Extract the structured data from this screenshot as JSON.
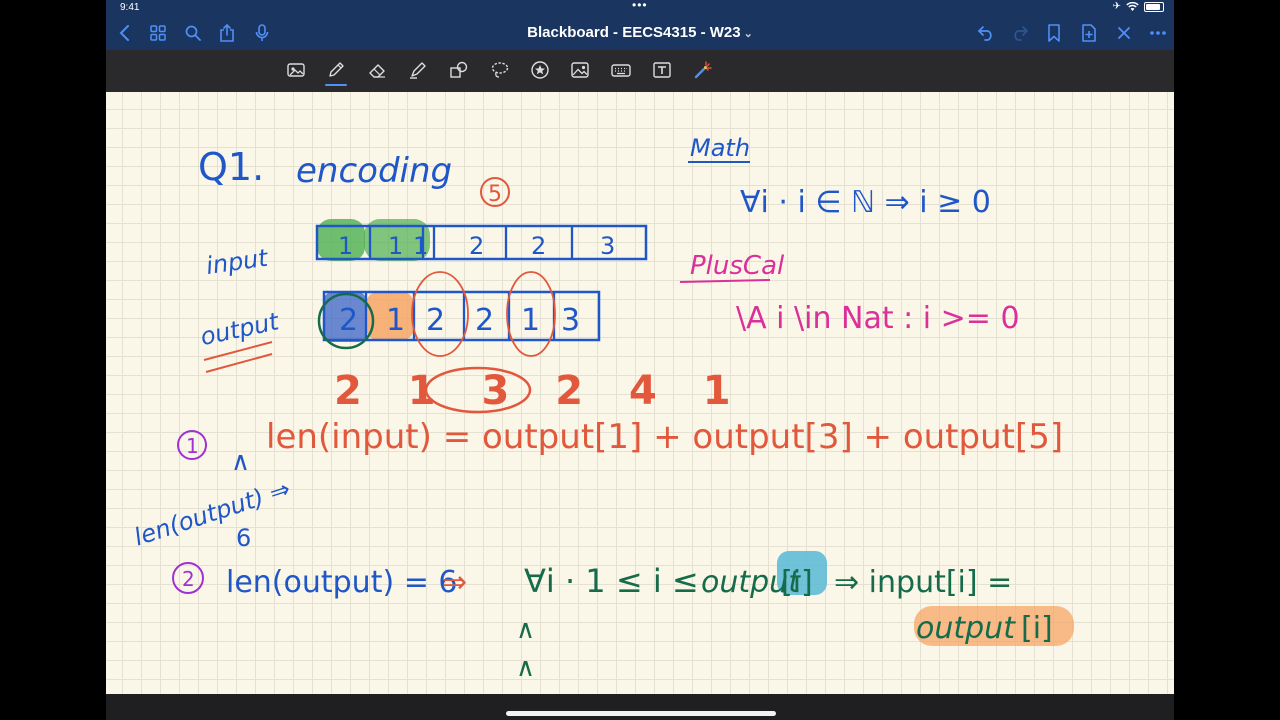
{
  "status_bar": {
    "time": "9:41"
  },
  "nav": {
    "title": "Blackboard - EECS4315 - W23",
    "left_icons": [
      "back-icon",
      "grid-icon",
      "search-icon",
      "share-icon",
      "microphone-icon"
    ],
    "right_icons": [
      "undo-icon",
      "redo-icon",
      "bookmark-icon",
      "add-page-icon",
      "close-icon",
      "more-icon"
    ]
  },
  "toolbar": {
    "tools": [
      "image-scan-icon",
      "pen-icon",
      "eraser-icon",
      "highlighter-icon",
      "shapes-icon",
      "lasso-icon",
      "sticker-icon",
      "photo-icon",
      "keyboard-icon",
      "text-box-icon",
      "laser-pointer-icon"
    ],
    "active_tool": "pen-icon"
  },
  "colors": {
    "accent": "#4f8ff7",
    "nav_background": "#1a3660",
    "paper": "#faf6e8",
    "ink_blue": "#1f57c8",
    "ink_red": "#e2583c",
    "ink_pink": "#db2f9a",
    "ink_green": "#156b4a",
    "ink_purple": "#a031d2",
    "highlight_green": "#4caf50",
    "highlight_orange": "#f6a15c",
    "highlight_cyan": "#57b9d6"
  },
  "notes": {
    "q1": "Q1.",
    "encoding": "encoding",
    "circled_five": "5",
    "input_label": "input",
    "input_cells": [
      "1",
      "1",
      "1",
      "2",
      "2",
      "3"
    ],
    "output_label": "output",
    "output_cells": [
      "2",
      "1",
      "2",
      "2",
      "1",
      "3"
    ],
    "red_digits": "2 1 3 2 4 1",
    "math_title": "Math",
    "math_formula": "∀i · i ∈ ℕ ⇒ i ≥ 0",
    "pluscal_title": "PlusCal",
    "pluscal_formula": "\\A i \\in Nat : i >= 0",
    "step1_number": "1",
    "step1_formula": "len(input) = output[1] + output[3] + output[5]",
    "step1_and": "∧",
    "step1_len_output": "len(output) ⇒",
    "step1_six": "6",
    "step2_number": "2",
    "step2_lhs": "len(output) = 6",
    "step2_implies": "⇒",
    "step2_quant": "∀i · 1 ≤ i ≤",
    "step2_output1": "output",
    "step2_output_index": "[i]",
    "step2_rhs": "⇒ input[i] =",
    "step2_output2": "output",
    "step2_output2_index": "[i]",
    "step2_and1": "∧",
    "step2_and2": "∧"
  }
}
